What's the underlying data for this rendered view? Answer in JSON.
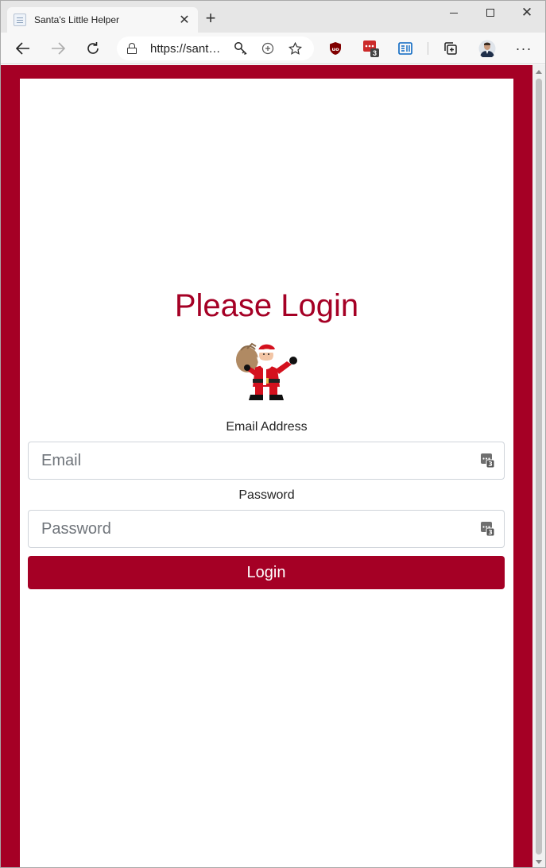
{
  "browser": {
    "tab": {
      "title": "Santa's Little Helper",
      "close_glyph": "✕"
    },
    "new_tab_glyph": "+",
    "window_controls": {
      "close_glyph": "✕"
    },
    "address": {
      "url": "https://santas-little-helper..."
    },
    "extensions": {
      "password_manager_badge": "3",
      "more_glyph": "···"
    },
    "icons": [
      "back-icon",
      "forward-icon",
      "refresh-icon",
      "lock-icon",
      "key-icon",
      "zoom-icon",
      "favorite-star-icon",
      "ublock-icon",
      "password-manager-icon",
      "immersive-reader-icon",
      "collections-icon",
      "profile-avatar-icon",
      "more-icon"
    ]
  },
  "page": {
    "colors": {
      "brand": "#a50025",
      "card": "#ffffff"
    },
    "title": "Please Login",
    "mascot": "santa-claus-icon",
    "email": {
      "label": "Email Address",
      "placeholder": "Email",
      "value": ""
    },
    "password": {
      "label": "Password",
      "placeholder": "Password",
      "value": ""
    },
    "field_icon_badge": "3",
    "login_button": "Login"
  }
}
